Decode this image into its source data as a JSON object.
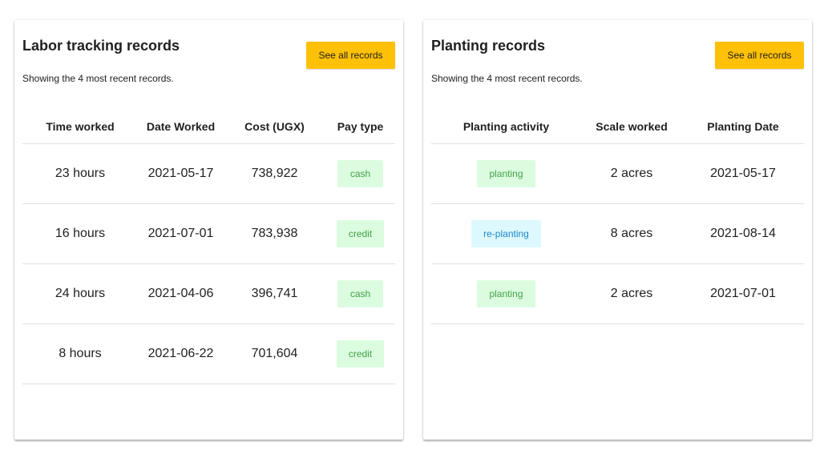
{
  "labor": {
    "title": "Labor tracking records",
    "subtitle": "Showing the 4 most recent records.",
    "see_all_label": "See all records",
    "columns": [
      "Time worked",
      "Date Worked",
      "Cost (UGX)",
      "Pay type"
    ],
    "rows": [
      {
        "time": "23 hours",
        "date": "2021-05-17",
        "cost": "738,922",
        "pay": "cash"
      },
      {
        "time": "16 hours",
        "date": "2021-07-01",
        "cost": "783,938",
        "pay": "credit"
      },
      {
        "time": "24 hours",
        "date": "2021-04-06",
        "cost": "396,741",
        "pay": "cash"
      },
      {
        "time": "8 hours",
        "date": "2021-06-22",
        "cost": "701,604",
        "pay": "credit"
      }
    ]
  },
  "planting": {
    "title": "Planting records",
    "subtitle": "Showing the 4 most recent records.",
    "see_all_label": "See all records",
    "columns": [
      "Planting activity",
      "Scale worked",
      "Planting Date"
    ],
    "rows": [
      {
        "activity": "planting",
        "scale": "2 acres",
        "date": "2021-05-17"
      },
      {
        "activity": "re-planting",
        "scale": "8 acres",
        "date": "2021-08-14"
      },
      {
        "activity": "planting",
        "scale": "2 acres",
        "date": "2021-07-01"
      }
    ]
  },
  "colors": {
    "accent_button": "#ffc107",
    "chip_green_bg": "#dcfce0",
    "chip_green_text": "#43a047",
    "chip_blue_bg": "#ddf8ff",
    "chip_blue_text": "#1e88c8"
  }
}
